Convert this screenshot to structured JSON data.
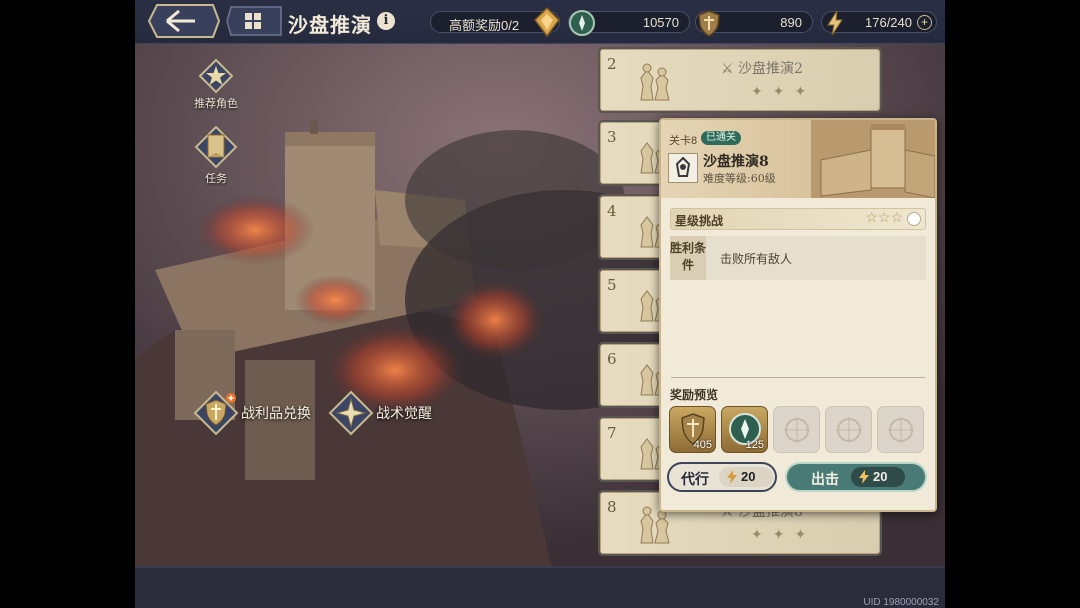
{
  "header": {
    "title": "沙盘推演",
    "reward_label": "高额奖励0/2",
    "resources": [
      {
        "icon": "compass-coin-icon",
        "value": "10570"
      },
      {
        "icon": "shield-medal-icon",
        "value": "890"
      },
      {
        "icon": "stamina-bolt-icon",
        "value": "176/240"
      }
    ]
  },
  "map": {
    "recommend_label": "推荐角色",
    "task_label": "任务",
    "exchange_label": "战利品兑换",
    "awaken_label": "战术觉醒"
  },
  "stages": [
    {
      "num": "2",
      "name": "沙盘推演2",
      "stars": "✦✦✦"
    },
    {
      "num": "3"
    },
    {
      "num": "4"
    },
    {
      "num": "5"
    },
    {
      "num": "6"
    },
    {
      "num": "7"
    },
    {
      "num": "8",
      "name": "沙盘推演8",
      "stars": "✦✦✦"
    }
  ],
  "detail": {
    "stage_no": "关卡8",
    "status": "已通关",
    "title": "沙盘推演8",
    "difficulty": "难度等级:60级",
    "star_challenge": "星级挑战",
    "star_rating": "☆☆☆",
    "win_label": "胜利条件",
    "win_condition": "击败所有敌人",
    "reward_title": "奖励预览",
    "rewards": [
      {
        "icon": "shield-medal-icon",
        "count": "405"
      },
      {
        "icon": "compass-coin-icon",
        "count": "125"
      }
    ],
    "proxy_label": "代行",
    "proxy_cost": "20",
    "go_label": "出击",
    "go_cost": "20"
  },
  "footer": {
    "uid": "UID 1980000032"
  },
  "colors": {
    "accent_gold": "#c9b58c",
    "go_teal": "#4a7a76",
    "bar_navy": "#2b2f45"
  }
}
